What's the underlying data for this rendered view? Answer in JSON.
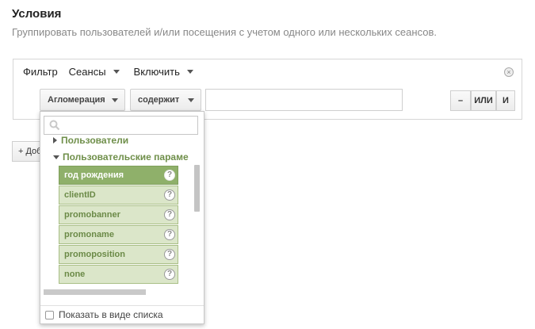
{
  "header": {
    "title": "Условия",
    "subtitle": "Группировать пользователей и/или посещения с учетом одного или нескольких сеансов."
  },
  "filter": {
    "label": "Фильтр",
    "scope": "Сеансы",
    "mode": "Включить",
    "dimension": "Агломерация",
    "operator": "содержит",
    "value": "",
    "buttons": {
      "minus": "–",
      "or": "ИЛИ",
      "and": "И"
    }
  },
  "add_button": "+ Доб",
  "dropdown": {
    "search_placeholder": "",
    "groups": [
      {
        "label": "Пользователи",
        "expanded": false
      },
      {
        "label": "Пользовательские параме",
        "expanded": true
      }
    ],
    "items": [
      {
        "label": "год рождения",
        "active": true
      },
      {
        "label": "clientID",
        "active": false
      },
      {
        "label": "promobanner",
        "active": false
      },
      {
        "label": "promoname",
        "active": false
      },
      {
        "label": "promoposition",
        "active": false
      },
      {
        "label": "none",
        "active": false
      }
    ],
    "help_glyph": "?",
    "list_view_label": "Показать в виде списка"
  },
  "colors": {
    "accent_green": "#8fb06a",
    "item_bg": "#dbe6c9",
    "group_text": "#6f8f4a"
  }
}
